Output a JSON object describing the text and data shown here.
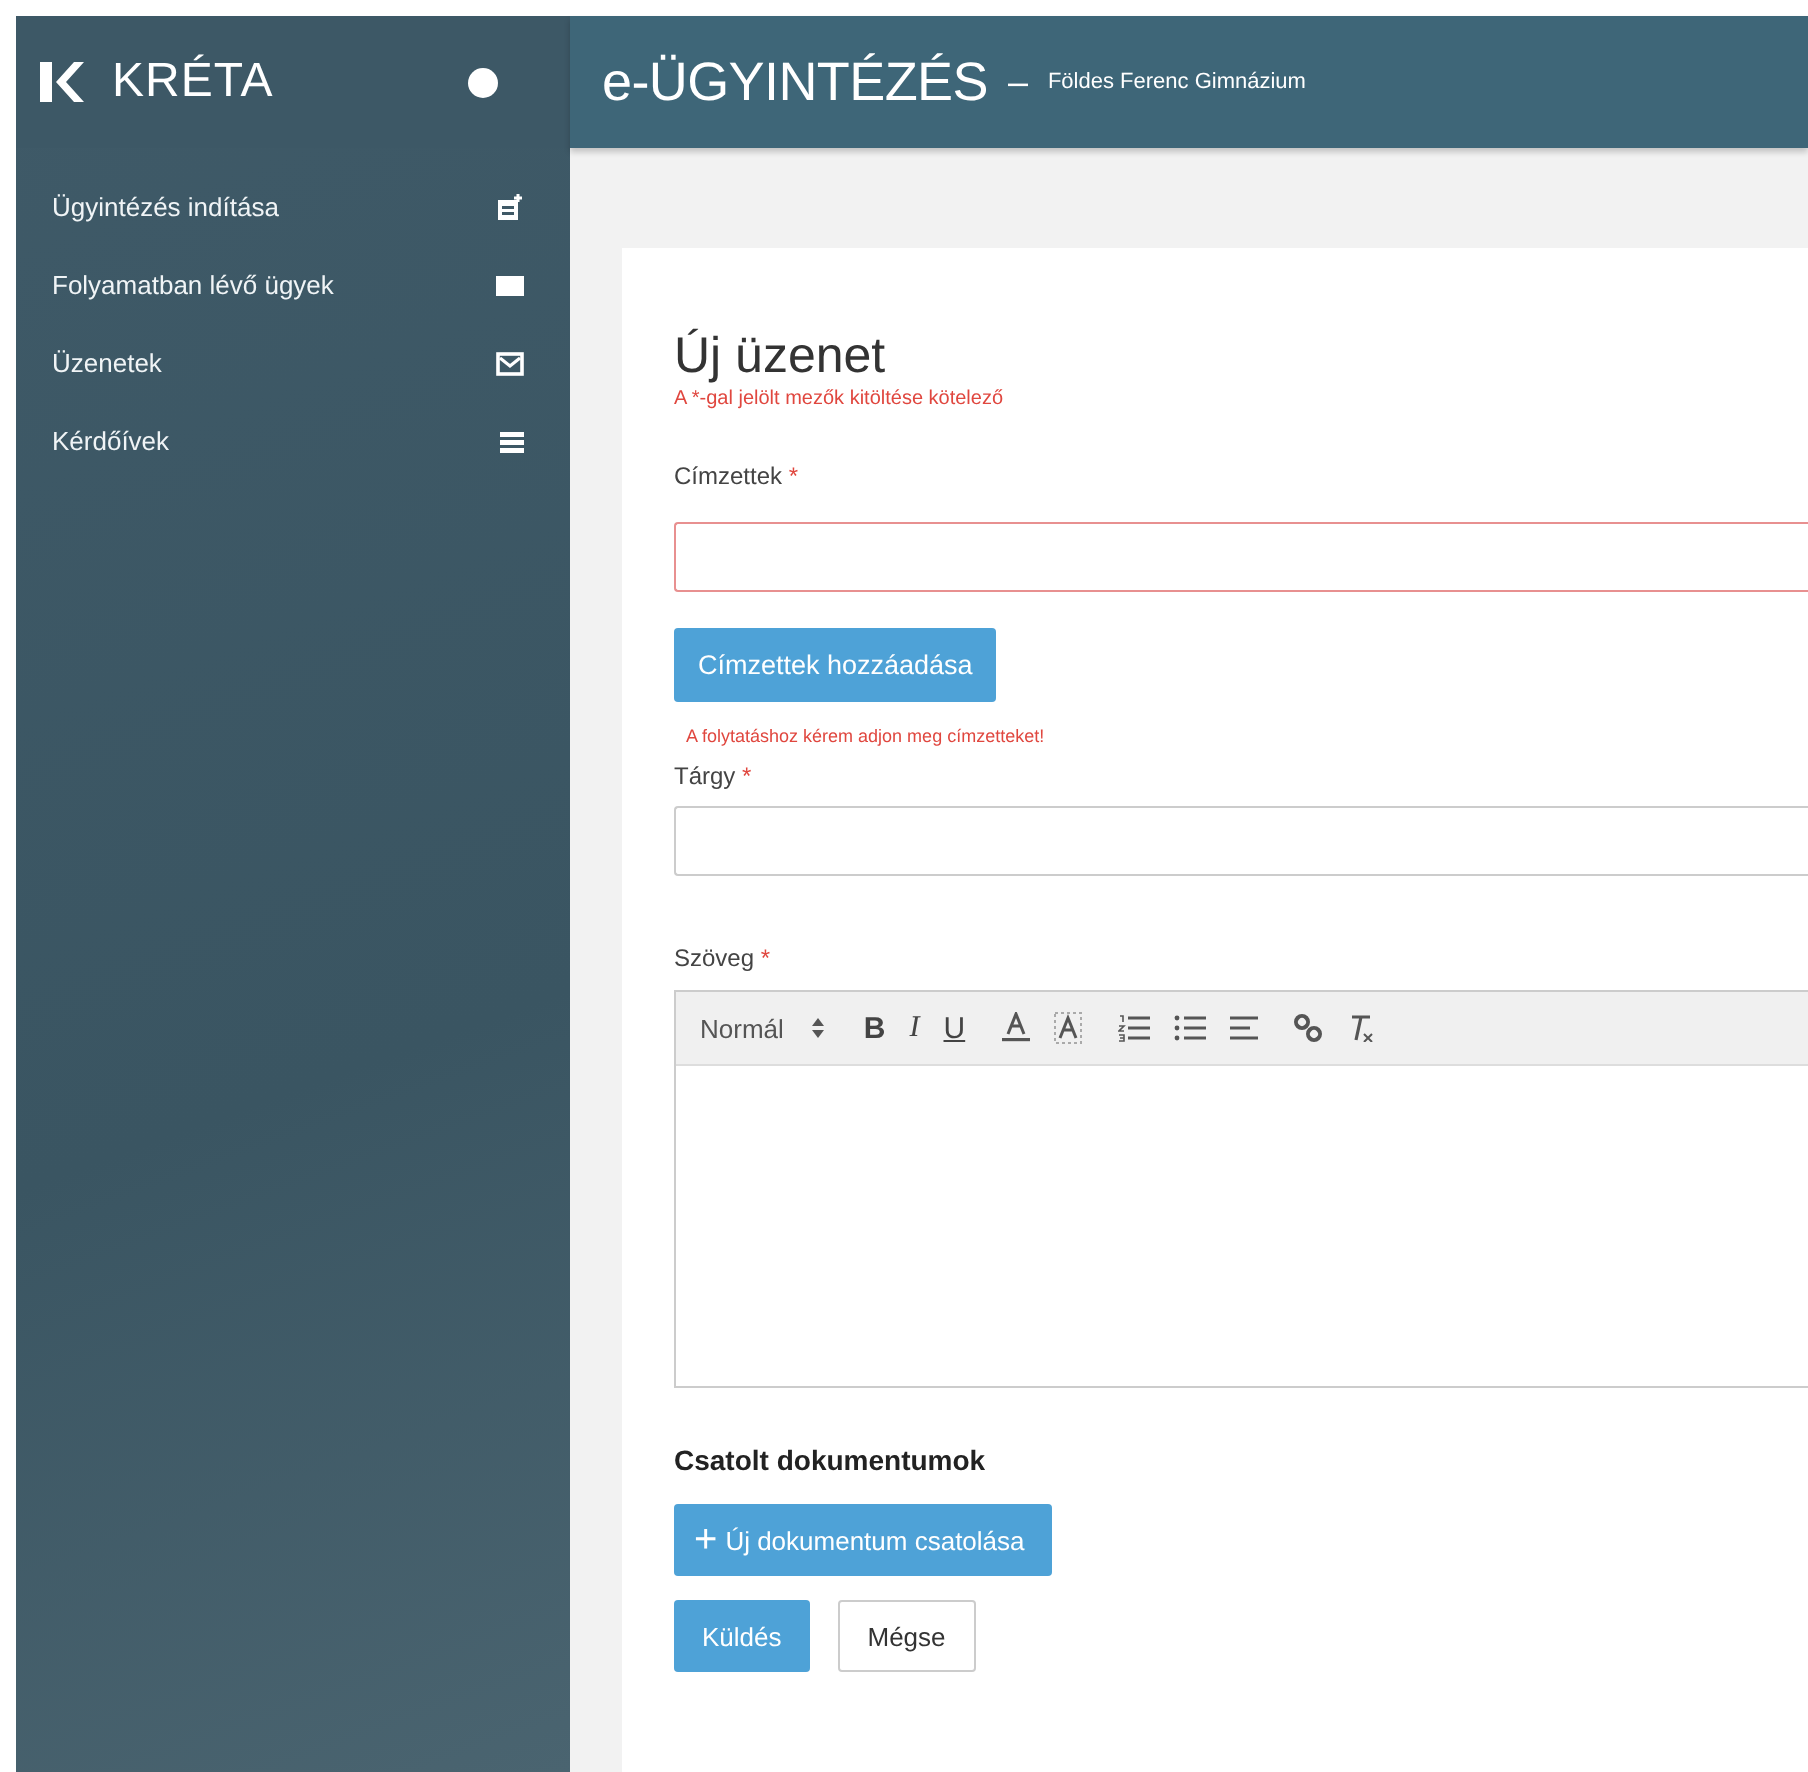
{
  "sidebar": {
    "brand": "KRÉTA",
    "items": [
      {
        "label": "Ügyintézés indítása",
        "kind": "new"
      },
      {
        "label": "Folyamatban lévő ügyek",
        "kind": "folder"
      },
      {
        "label": "Üzenetek",
        "kind": "mail"
      },
      {
        "label": "Kérdőívek",
        "kind": "list"
      }
    ]
  },
  "header": {
    "title": "e-ÜGYINTÉZÉS",
    "separator": "–",
    "school": "Földes Ferenc Gimnázium"
  },
  "form": {
    "title": "Új üzenet",
    "required_note": "A *-gal jelölt mezők kitöltése kötelező",
    "recipients": {
      "label": "Címzettek",
      "required_mark": "*",
      "invalid": true,
      "button": "Címzettek hozzáadása",
      "error": "A folytatáshoz kérem adjon meg címzetteket!"
    },
    "subject": {
      "label": "Tárgy",
      "required_mark": "*",
      "invalid": false
    },
    "body": {
      "label": "Szöveg",
      "required_mark": "*",
      "toolbar": {
        "format": "Normál",
        "tools": [
          {
            "kind": "bold",
            "label": "B"
          },
          {
            "kind": "italic",
            "label": "I"
          },
          {
            "kind": "underline",
            "label": "U"
          },
          {
            "kind": "color"
          },
          {
            "kind": "background"
          },
          {
            "kind": "ordered-list"
          },
          {
            "kind": "bullet-list"
          },
          {
            "kind": "align"
          },
          {
            "kind": "link"
          },
          {
            "kind": "clear"
          }
        ]
      }
    },
    "attachments": {
      "heading": "Csatolt dokumentumok",
      "button_icon": "+",
      "button": "Új dokumentum csatolása"
    },
    "actions": [
      {
        "label": "Küldés",
        "kind": "primary"
      },
      {
        "label": "Mégse",
        "kind": "default"
      }
    ]
  }
}
